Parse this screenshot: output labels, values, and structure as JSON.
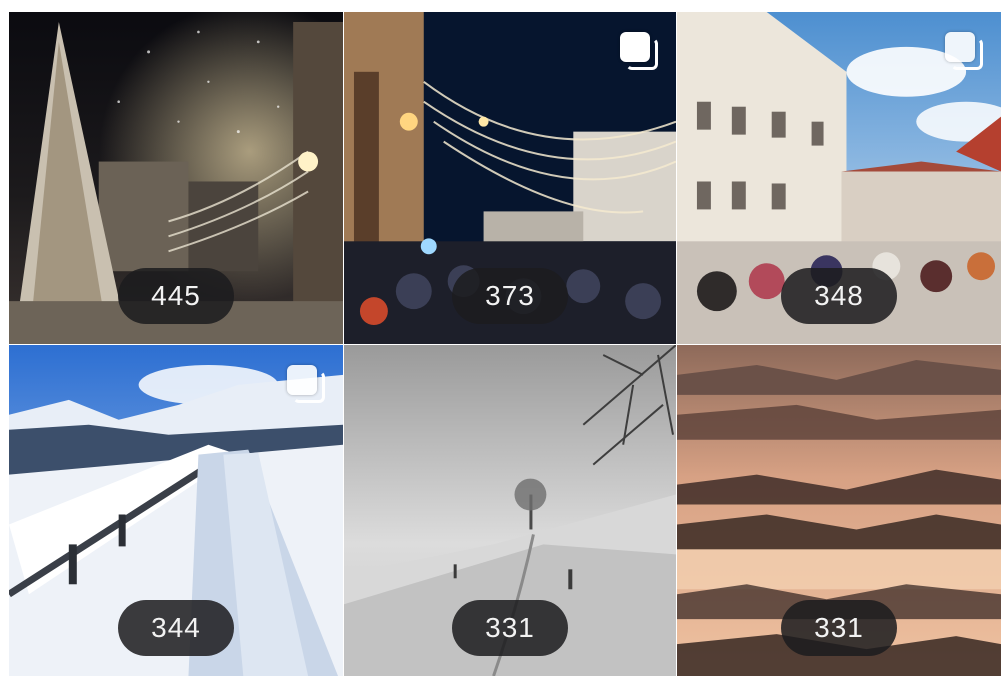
{
  "grid": {
    "tiles": [
      {
        "subject": "christmas-tree-street-night",
        "count": "445",
        "multiple": false
      },
      {
        "subject": "christmas-market-lights-crowd",
        "count": "373",
        "multiple": true
      },
      {
        "subject": "town-square-carnival",
        "count": "348",
        "multiple": true
      },
      {
        "subject": "snowy-mountain-railing",
        "count": "344",
        "multiple": true
      },
      {
        "subject": "snowy-path-tree-fog",
        "count": "331",
        "multiple": false
      },
      {
        "subject": "foggy-valley-sunrise",
        "count": "331",
        "multiple": false
      }
    ]
  },
  "icons": {
    "multi_photo": "multiple-photos-icon"
  },
  "colors": {
    "badge_bg": "#1c1c1e",
    "badge_text": "#f2f2f2"
  }
}
